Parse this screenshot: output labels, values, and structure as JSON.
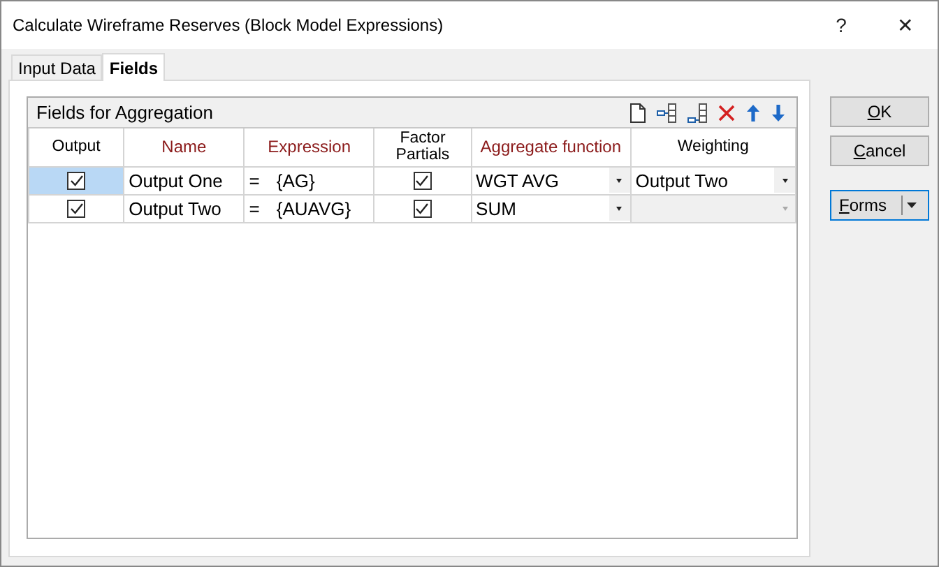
{
  "window": {
    "title": "Calculate Wireframe Reserves (Block Model Expressions)",
    "help": "?",
    "close": "✕"
  },
  "tabs": [
    {
      "label": "Input Data",
      "selected": false
    },
    {
      "label": "Fields",
      "selected": true
    }
  ],
  "grid": {
    "title": "Fields for Aggregation",
    "columns": [
      {
        "label": "Output",
        "required": false
      },
      {
        "label": "Name",
        "required": true
      },
      {
        "label": "Expression",
        "required": true
      },
      {
        "label": "Factor Partials",
        "required": false
      },
      {
        "label": "Aggregate function",
        "required": true
      },
      {
        "label": "Weighting",
        "required": false
      }
    ],
    "rows": [
      {
        "output": true,
        "output_selected": true,
        "name": "Output One",
        "eq": "=",
        "expression": "{AG}",
        "factor_partials": true,
        "aggregate": "WGT AVG",
        "weighting": "Output Two",
        "weighting_disabled": false
      },
      {
        "output": true,
        "output_selected": false,
        "name": "Output Two",
        "eq": "=",
        "expression": "{AUAVG}",
        "factor_partials": true,
        "aggregate": "SUM",
        "weighting_disabled": true
      }
    ]
  },
  "buttons": [
    {
      "label": "OK",
      "kind": "plain"
    },
    {
      "label": "Cancel",
      "kind": "plain"
    },
    {
      "label": "Forms",
      "kind": "split"
    }
  ]
}
